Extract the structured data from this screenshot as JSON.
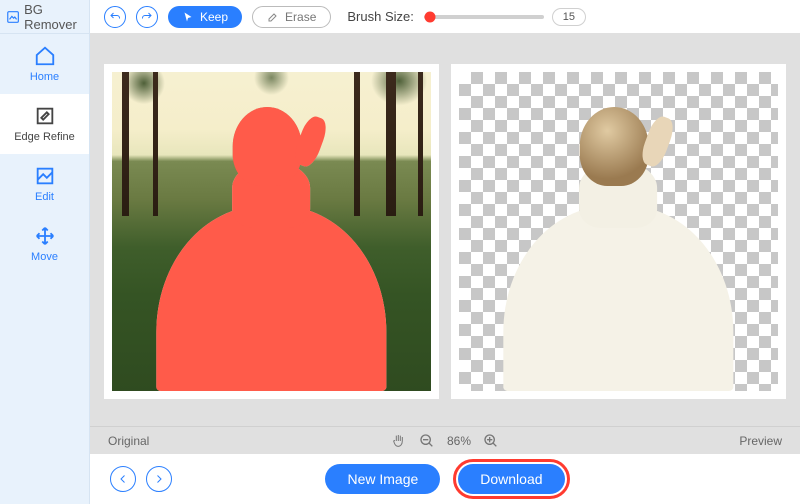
{
  "brand": {
    "name": "BG Remover"
  },
  "sidebar": {
    "items": [
      {
        "label": "Home"
      },
      {
        "label": "Edge Refine"
      },
      {
        "label": "Edit"
      },
      {
        "label": "Move"
      }
    ]
  },
  "toolbar": {
    "keep_label": "Keep",
    "erase_label": "Erase",
    "brush_label": "Brush Size:",
    "brush_value": "15"
  },
  "status": {
    "original_label": "Original",
    "zoom_level": "86%",
    "preview_label": "Preview"
  },
  "footer": {
    "new_image_label": "New Image",
    "download_label": "Download"
  },
  "colors": {
    "primary": "#2a7fff",
    "sidebar_bg": "#e8f2fc",
    "mask": "#ff5b4a",
    "highlight": "#ff3b30"
  }
}
